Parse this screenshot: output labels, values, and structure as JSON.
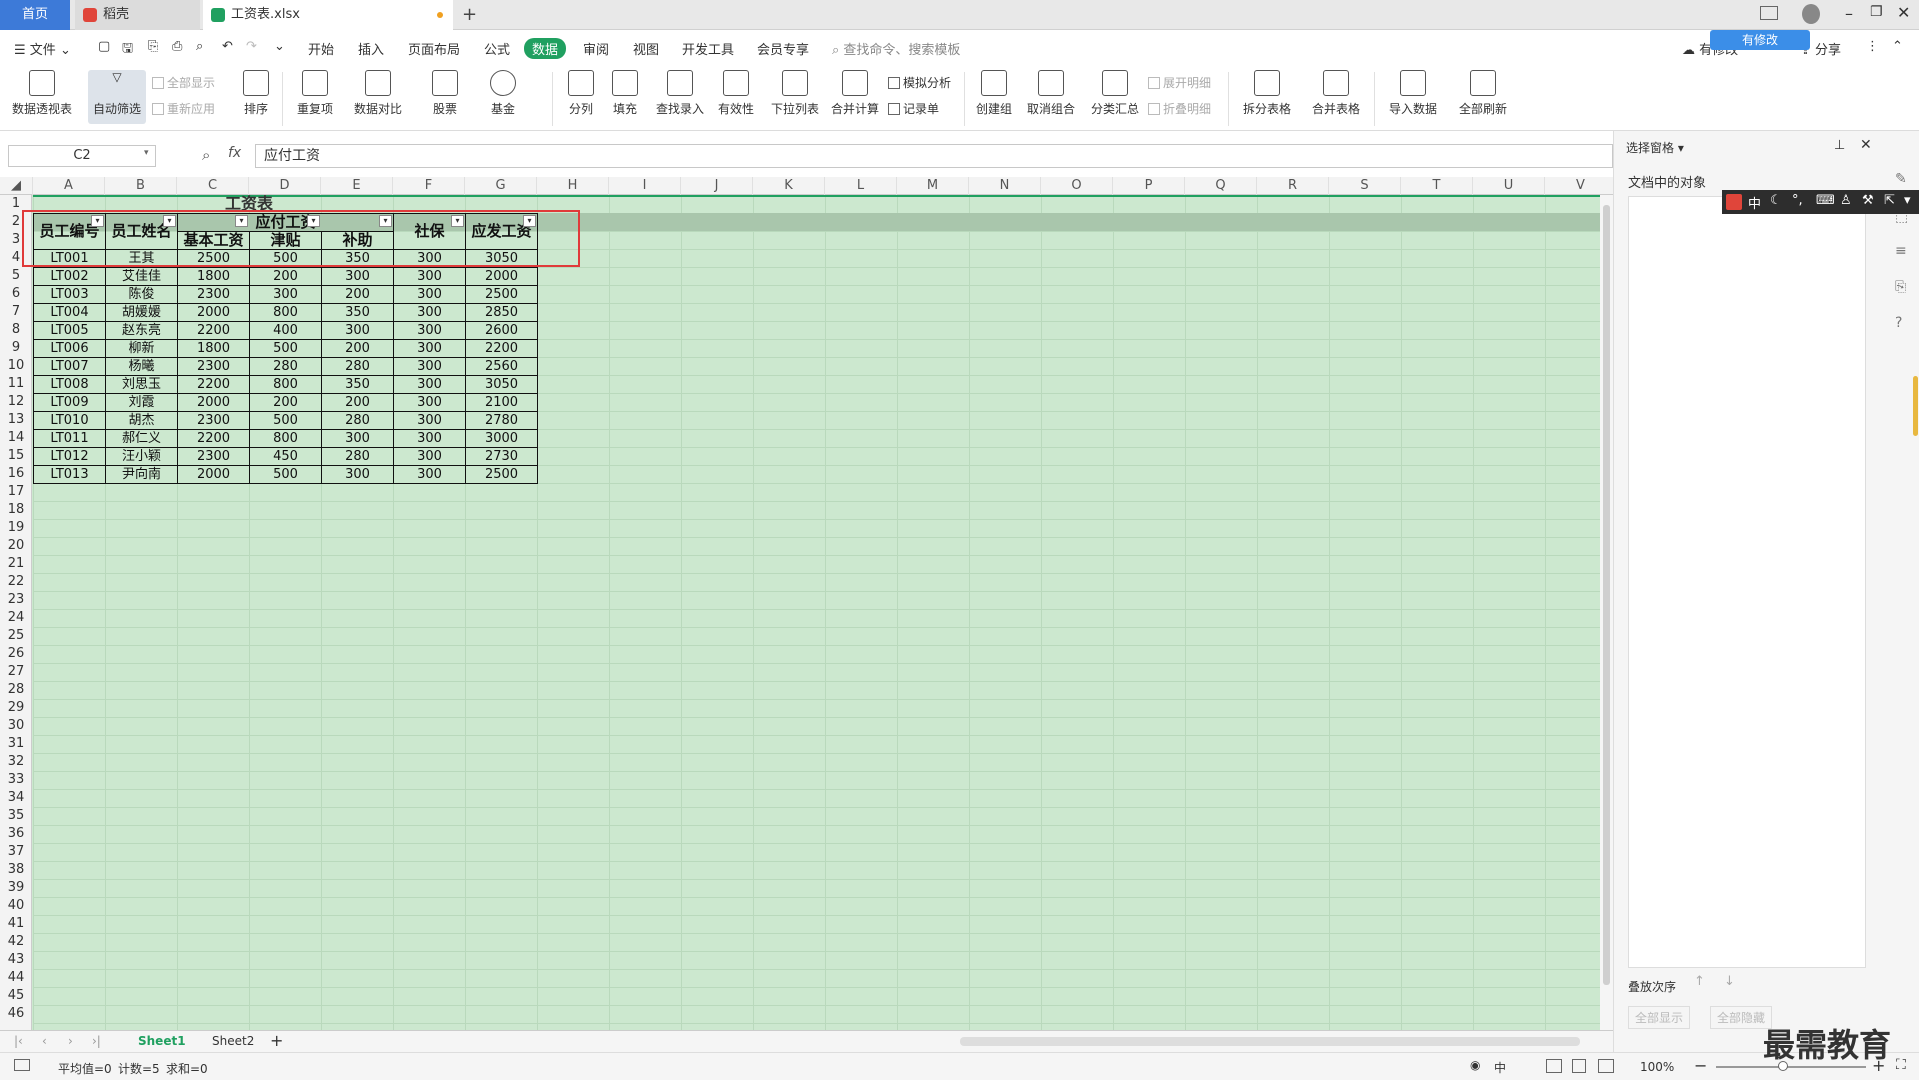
{
  "tabs": {
    "home": "首页",
    "docer": "稻壳",
    "file": "工资表.xlsx",
    "new_tab": "+"
  },
  "menu": {
    "file": "文件",
    "items": [
      "开始",
      "插入",
      "页面布局",
      "公式",
      "数据",
      "审阅",
      "视图",
      "开发工具",
      "会员专享"
    ],
    "active": "数据",
    "search_placeholder": "查找命令、搜索模板",
    "unsync": "有修改",
    "share": "分享",
    "cloud_badge": "有修改"
  },
  "ribbon": {
    "pivot": "数据透视表",
    "autofilter": "自动筛选",
    "show_all": "全部显示",
    "reapply": "重新应用",
    "sort": "排序",
    "duplicates": "重复项",
    "compare": "数据对比",
    "stock": "股票",
    "fund": "基金",
    "split": "分列",
    "fill": "填充",
    "lookup": "查找录入",
    "validity": "有效性",
    "dropdown": "下拉列表",
    "consolidate": "合并计算",
    "whatif": "模拟分析",
    "record": "记录单",
    "group": "创建组",
    "ungroup": "取消组合",
    "subtotal": "分类汇总",
    "expand": "展开明细",
    "collapse": "折叠明细",
    "split_table": "拆分表格",
    "merge_table": "合并表格",
    "import": "导入数据",
    "refresh_all": "全部刷新"
  },
  "formula_bar": {
    "cell_ref": "C2",
    "fx": "fx",
    "content": "应付工资"
  },
  "columns": [
    "A",
    "B",
    "C",
    "D",
    "E",
    "F",
    "G",
    "H",
    "I",
    "J",
    "K",
    "L",
    "M",
    "N",
    "O",
    "P",
    "Q",
    "R",
    "S",
    "T",
    "U",
    "V"
  ],
  "rows": [
    "1",
    "2",
    "3",
    "4",
    "5",
    "6",
    "7",
    "8",
    "9",
    "10",
    "11",
    "12",
    "13",
    "14",
    "15",
    "16",
    "17",
    "18",
    "19",
    "20",
    "21",
    "22",
    "23",
    "24",
    "25",
    "26",
    "27",
    "28",
    "29",
    "30",
    "31",
    "32",
    "33",
    "34",
    "35",
    "36",
    "37",
    "38",
    "39",
    "40",
    "41",
    "42",
    "43",
    "44",
    "45",
    "46"
  ],
  "sheet": {
    "title": "工资表",
    "header": {
      "id": "员工编号",
      "name": "员工姓名",
      "payable": "应付工资",
      "social": "社保",
      "actual": "应发工资"
    },
    "subheader": {
      "base": "基本工资",
      "allowance": "津贴",
      "subsidy": "补助"
    },
    "data": [
      [
        "LT001",
        "王其",
        "2500",
        "500",
        "350",
        "300",
        "3050"
      ],
      [
        "LT002",
        "艾佳佳",
        "1800",
        "200",
        "300",
        "300",
        "2000"
      ],
      [
        "LT003",
        "陈俊",
        "2300",
        "300",
        "200",
        "300",
        "2500"
      ],
      [
        "LT004",
        "胡媛媛",
        "2000",
        "800",
        "350",
        "300",
        "2850"
      ],
      [
        "LT005",
        "赵东亮",
        "2200",
        "400",
        "300",
        "300",
        "2600"
      ],
      [
        "LT006",
        "柳新",
        "1800",
        "500",
        "200",
        "300",
        "2200"
      ],
      [
        "LT007",
        "杨曦",
        "2300",
        "280",
        "280",
        "300",
        "2560"
      ],
      [
        "LT008",
        "刘思玉",
        "2200",
        "800",
        "350",
        "300",
        "3050"
      ],
      [
        "LT009",
        "刘霞",
        "2000",
        "200",
        "200",
        "300",
        "2100"
      ],
      [
        "LT010",
        "胡杰",
        "2300",
        "500",
        "280",
        "300",
        "2780"
      ],
      [
        "LT011",
        "郝仁义",
        "2200",
        "800",
        "300",
        "300",
        "3000"
      ],
      [
        "LT012",
        "汪小颖",
        "2300",
        "450",
        "280",
        "300",
        "2730"
      ],
      [
        "LT013",
        "尹向南",
        "2000",
        "500",
        "300",
        "300",
        "2500"
      ]
    ]
  },
  "sheet_tabs": [
    "Sheet1",
    "Sheet2"
  ],
  "status": {
    "avg": "平均值=0",
    "count": "计数=5",
    "sum": "求和=0",
    "zoom": "100%",
    "ime": "中"
  },
  "pane": {
    "title": "选择窗格",
    "objects_label": "文档中的对象",
    "order_label": "叠放次序",
    "show_all": "全部显示",
    "hide_all": "全部隐藏"
  },
  "ime_bar": "中",
  "watermark": "最需教育"
}
